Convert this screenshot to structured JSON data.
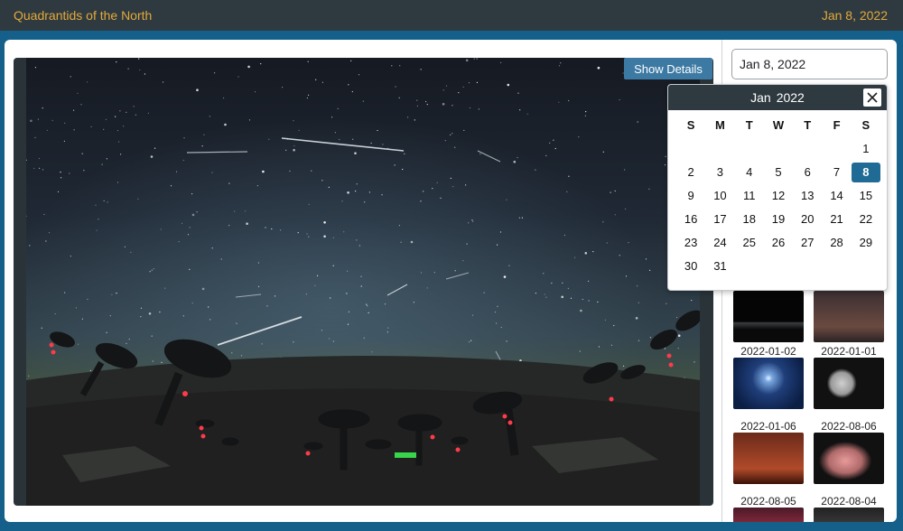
{
  "header": {
    "title": "Quadrantids of the North",
    "date": "Jan 8, 2022"
  },
  "viewer": {
    "show_details_label": "Show Details"
  },
  "date_picker": {
    "value": "Jan 8, 2022"
  },
  "calendar": {
    "month": "Jan",
    "year": "2022",
    "weekdays": [
      "S",
      "M",
      "T",
      "W",
      "T",
      "F",
      "S"
    ],
    "weeks": [
      [
        "",
        "",
        "",
        "",
        "",
        "",
        "1"
      ],
      [
        "2",
        "3",
        "4",
        "5",
        "6",
        "7",
        "8"
      ],
      [
        "9",
        "10",
        "11",
        "12",
        "13",
        "14",
        "15"
      ],
      [
        "16",
        "17",
        "18",
        "19",
        "20",
        "21",
        "22"
      ],
      [
        "23",
        "24",
        "25",
        "26",
        "27",
        "28",
        "29"
      ],
      [
        "30",
        "31",
        "",
        "",
        "",
        "",
        ""
      ]
    ],
    "selected_day": "8"
  },
  "thumbnails": [
    {
      "date": ""
    },
    {
      "date": ""
    },
    {
      "date": "2022-01-02"
    },
    {
      "date": "2022-01-01"
    },
    {
      "date": "2022-01-06"
    },
    {
      "date": "2022-08-06"
    },
    {
      "date": "2022-08-05"
    },
    {
      "date": "2022-08-04"
    }
  ],
  "colors": {
    "accent": "#e3a93a",
    "header_bg": "#2f3a40",
    "frame": "#14608a",
    "selected": "#1f6b95"
  }
}
